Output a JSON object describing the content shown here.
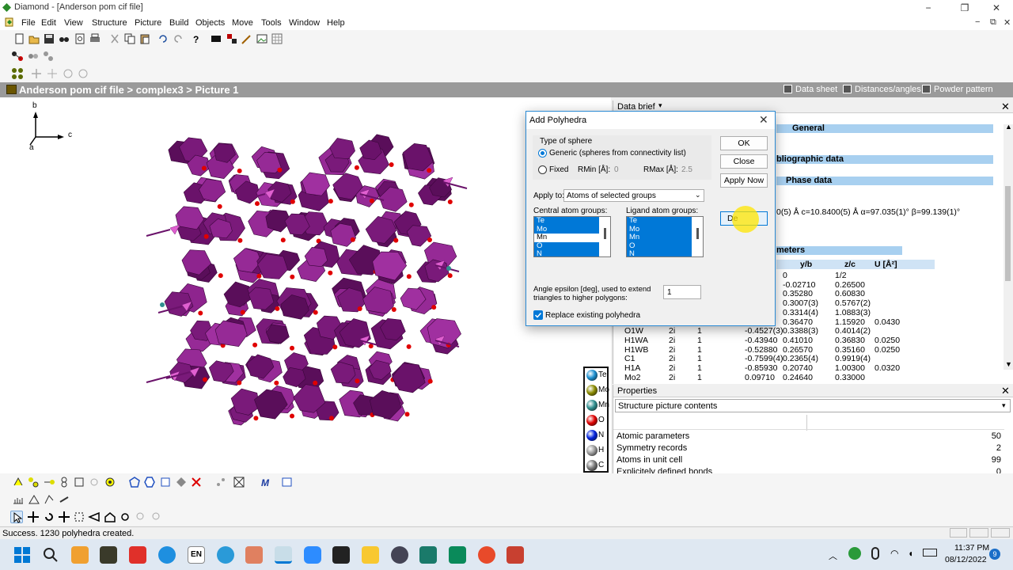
{
  "window": {
    "title": "Diamond - [Anderson pom cif file]",
    "controls": [
      "−",
      "❐",
      "✕"
    ],
    "mdi_controls": [
      "−",
      "⧉",
      "✕"
    ]
  },
  "menu": [
    "File",
    "Edit",
    "View",
    "Structure",
    "Picture",
    "Build",
    "Objects",
    "Move",
    "Tools",
    "Window",
    "Help"
  ],
  "breadcrumb": "Anderson pom cif file > complex3 > Picture 1",
  "top_tabs": [
    "Data sheet",
    "Distances/angles",
    "Powder pattern"
  ],
  "axes": {
    "b": "b",
    "c": "c",
    "a": "a"
  },
  "legend": [
    "Te",
    "Mo",
    "Mn",
    "O",
    "N",
    "H",
    "C"
  ],
  "legend_colors": [
    "#1a8fd0",
    "#8b8b00",
    "#2f8f8f",
    "#e00000",
    "#0022dd",
    "#999999",
    "#777777"
  ],
  "data_brief": {
    "header": "Data brief",
    "sections": {
      "general": "General",
      "bibliographic": "bliographic data",
      "phase": "Phase data"
    },
    "cell_line": "0(5) Å c=10.8400(5) Å α=97.035(1)° β=99.139(1)°",
    "params_header": "meters",
    "columns": [
      "y/b",
      "z/c",
      "U [Å²]"
    ],
    "rows": [
      {
        "label": "",
        "wy": "",
        "occ": "",
        "x": "",
        "y": "0",
        "z": "1/2",
        "u": ""
      },
      {
        "label": "",
        "wy": "",
        "occ": "",
        "x": "",
        "y": "-0.02710",
        "z": "0.26500",
        "u": ""
      },
      {
        "label": "",
        "wy": "",
        "occ": "",
        "x": "0",
        "y": "0.35280",
        "z": "0.60830",
        "u": ""
      },
      {
        "label": "",
        "wy": "",
        "occ": "",
        "x": "(3)",
        "y": "0.3007(3)",
        "z": "0.5767(2)",
        "u": ""
      },
      {
        "label": "",
        "wy": "",
        "occ": "",
        "x": "(4)",
        "y": "0.3314(4)",
        "z": "1.0883(3)",
        "u": ""
      },
      {
        "label": "",
        "wy": "",
        "occ": "",
        "x": "0",
        "y": "0.36470",
        "z": "1.15920",
        "u": "0.0430"
      },
      {
        "label": "O1W",
        "wy": "2i",
        "occ": "1",
        "x": "-0.4527(3)",
        "y": "0.3388(3)",
        "z": "0.4014(2)",
        "u": ""
      },
      {
        "label": "H1WA",
        "wy": "2i",
        "occ": "1",
        "x": "-0.43940",
        "y": "0.41010",
        "z": "0.36830",
        "u": "0.0250"
      },
      {
        "label": "H1WB",
        "wy": "2i",
        "occ": "1",
        "x": "-0.52880",
        "y": "0.26570",
        "z": "0.35160",
        "u": "0.0250"
      },
      {
        "label": "C1",
        "wy": "2i",
        "occ": "1",
        "x": "-0.7599(4)",
        "y": "0.2365(4)",
        "z": "0.9919(4)",
        "u": ""
      },
      {
        "label": "H1A",
        "wy": "2i",
        "occ": "1",
        "x": "-0.85930",
        "y": "0.20740",
        "z": "1.00300",
        "u": "0.0320"
      },
      {
        "label": "Mo2",
        "wy": "2i",
        "occ": "1",
        "x": "0.09710",
        "y": "0.24640",
        "z": "0.33000",
        "u": ""
      }
    ]
  },
  "properties": {
    "header": "Properties",
    "selected": "Structure picture contents",
    "rows": [
      {
        "name": "Atomic parameters",
        "value": "50"
      },
      {
        "name": "Symmetry records",
        "value": "2"
      },
      {
        "name": "Atoms in unit cell",
        "value": "99"
      },
      {
        "name": "Explicitely defined bonds",
        "value": "0"
      }
    ]
  },
  "status": "Success. 1230 polyhedra created.",
  "dialog": {
    "title": "Add Polyhedra",
    "type_of_sphere": "Type of sphere",
    "generic_label": "Generic (spheres from connectivity list)",
    "fixed_label": "Fixed",
    "rmin_label": "RMin [Å]:",
    "rmin_value": "0",
    "rmax_label": "RMax [Å]:",
    "rmax_value": "2.5",
    "apply_to_label": "Apply to:",
    "apply_to_value": "Atoms of selected groups",
    "central_label": "Central atom groups:",
    "ligand_label": "Ligand atom groups:",
    "central_items": [
      "Te",
      "Mo",
      "Mn",
      "O",
      "N"
    ],
    "ligand_items": [
      "Te",
      "Mo",
      "Mn",
      "O",
      "N"
    ],
    "epsilon_label": "Angle epsilon [deg], used to extend triangles to higher polygons:",
    "epsilon_value": "1",
    "replace_label": "Replace existing polyhedra",
    "ok": "OK",
    "close": "Close",
    "apply_now": "Apply Now",
    "default": "De"
  },
  "taskbar": {
    "time": "11:37 PM",
    "date": "08/12/2022",
    "lang": "EN",
    "notif": "9"
  }
}
